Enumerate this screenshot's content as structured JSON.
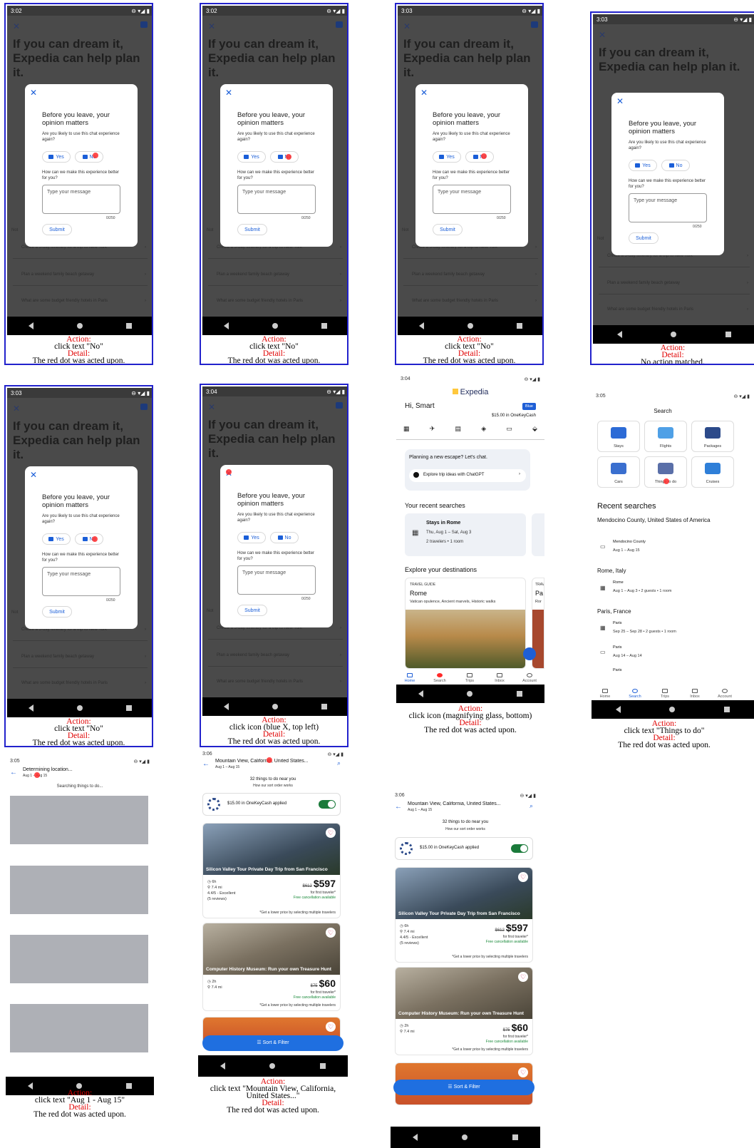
{
  "cells": [
    {
      "time": "3:02",
      "action": "click text \"No\"",
      "detail": "The red dot was acted upon."
    },
    {
      "time": "3:02",
      "action": "click text \"No\"",
      "detail": "The red dot was acted upon."
    },
    {
      "time": "3:03",
      "action": "click text \"No\"",
      "detail": "The red dot was acted upon."
    },
    {
      "time": "3:03",
      "action": "",
      "detail": "No action matched."
    },
    {
      "time": "3:03",
      "action": "click text \"No\"",
      "detail": "The red dot was acted upon."
    },
    {
      "time": "3:04",
      "action": "click icon (blue X, top left)",
      "detail": "The red dot was acted upon."
    },
    {
      "time": "3:04",
      "action": "click icon (magnifying glass, bottom)",
      "detail": "The red dot was acted upon."
    },
    {
      "time": "3:05",
      "action": "click text \"Things to do\"",
      "detail": "The red dot was acted upon."
    },
    {
      "time": "3:05",
      "action": "click text \"Aug 1 - Aug 15\"",
      "detail": "The red dot was acted upon."
    },
    {
      "time": "3:06",
      "action": "click text \"Mountain View, California, United States...\"",
      "detail": "The red dot was acted upon."
    },
    {
      "time": "3:06",
      "action": "",
      "detail": ""
    }
  ],
  "labels": {
    "action": "Action:",
    "detail": "Detail:"
  },
  "chat_screen": {
    "heading": "If you can dream it, Expedia can help plan it.",
    "suggestions": [
      "Create a 3-day itinerary for a trip to New York",
      "Plan a weekend family beach getaway",
      "What are some budget friendly hotels in Paris"
    ],
    "not_label": "Not"
  },
  "dialog": {
    "title": "Before you leave, your opinion matters",
    "question": "Are you likely to use this chat experience again?",
    "yes": "Yes",
    "no": "No",
    "question2": "How can we make this experience better for you?",
    "placeholder": "Type your message",
    "counter": "0/250",
    "submit": "Submit"
  },
  "home": {
    "brand": "Expedia",
    "greeting": "Hi, Smart",
    "tier": "Blue",
    "cash": "$15.00 in OneKeyCash",
    "chat_prompt": "Planning a new escape? Let's chat.",
    "chat_button": "Explore trip ideas with ChatGPT",
    "recent_title": "Your recent searches",
    "recent_card_title": "Stays in Rome",
    "recent_card_dates": "Thu, Aug 1 – Sat, Aug 3",
    "recent_card_guests": "2 travelers • 1 room",
    "explore_title": "Explore your destinations",
    "guide_label": "TRAVEL GUIDE",
    "guide_city": "Rome",
    "guide_desc": "Vatican opulence, Ancient marvels, Historic walks",
    "guide2_label": "TRAV",
    "guide2_city": "Pa",
    "guide2_desc": "Ror"
  },
  "tabs": [
    "Home",
    "Search",
    "Trips",
    "Inbox",
    "Account"
  ],
  "search_screen": {
    "title": "Search",
    "tiles": [
      "Stays",
      "Flights",
      "Packages",
      "Cars",
      "Things to do",
      "Cruises"
    ],
    "recent_title": "Recent searches",
    "groups": [
      {
        "place": "Mendocino County, United States of America",
        "items": [
          {
            "name": "Mendocino County",
            "detail": "Aug 1 – Aug 15"
          }
        ]
      },
      {
        "place": "Rome, Italy",
        "items": [
          {
            "name": "Rome",
            "detail": "Aug 1 – Aug 3 • 2 guests • 1 room"
          }
        ]
      },
      {
        "place": "Paris, France",
        "items": [
          {
            "name": "Paris",
            "detail": "Sep 25 – Sep 28 • 2 guests • 1 room"
          },
          {
            "name": "Paris",
            "detail": "Aug 14 – Aug 14"
          },
          {
            "name": "Paris",
            "detail": ""
          }
        ]
      }
    ]
  },
  "loading_screen": {
    "title": "Determining location...",
    "dates": "Aug 1 – Aug 15",
    "status": "Searching things to do..."
  },
  "results": {
    "location": "Mountain View, California, United States...",
    "dates": "Aug 1 – Aug 15",
    "count": "32 things to do near you",
    "sort_note": "How our sort order works",
    "cash_applied": "$15.00 in OneKeyCash applied",
    "sort_filter": "Sort & Filter",
    "multi_note": "*Get a lower price by selecting multiple travelers",
    "items": [
      {
        "title": "Silicon Valley Tour Private Day Trip from San Francisco",
        "duration": "6h",
        "distance": "7.4 mi",
        "rating": "4.4/5 - Excellent",
        "reviews": "(5 reviews)",
        "old_price": "$612",
        "price": "$597",
        "per": "for first traveler*",
        "cancel": "Free cancellation available"
      },
      {
        "title": "Computer History Museum: Run your own Treasure Hunt",
        "duration": "2h",
        "distance": "7.4 mi",
        "old_price": "$75",
        "price": "$60",
        "per": "for first traveler*",
        "cancel": "Free cancellation available"
      }
    ]
  }
}
